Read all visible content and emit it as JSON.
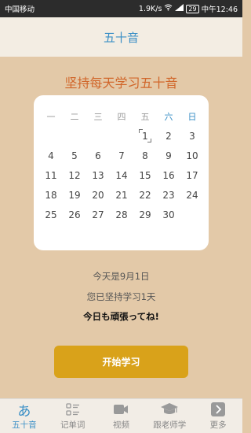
{
  "status": {
    "carrier": "中国移动",
    "speed": "1.9K/s",
    "battery": "29",
    "time": "中午12:46"
  },
  "header": {
    "title": "五十音"
  },
  "main": {
    "heading": "坚持每天学习五十音"
  },
  "calendar": {
    "weekdays": [
      "一",
      "二",
      "三",
      "四",
      "五",
      "六",
      "日"
    ],
    "days": [
      "",
      "",
      "",
      "",
      "1",
      "2",
      "3",
      "4",
      "5",
      "6",
      "7",
      "8",
      "9",
      "10",
      "11",
      "12",
      "13",
      "14",
      "15",
      "16",
      "17",
      "18",
      "19",
      "20",
      "21",
      "22",
      "23",
      "24",
      "25",
      "26",
      "27",
      "28",
      "29",
      "30",
      ""
    ],
    "today": "1"
  },
  "info": {
    "date_text": "今天是9月1日",
    "streak_text": "您已坚持学习1天",
    "motto": "今日も頑張ってね!"
  },
  "start_button": {
    "label": "开始学习"
  },
  "tabs": [
    {
      "label": "五十音",
      "icon": "hiragana-a-icon",
      "active": true
    },
    {
      "label": "记单词",
      "icon": "list-icon",
      "active": false
    },
    {
      "label": "视频",
      "icon": "video-icon",
      "active": false
    },
    {
      "label": "跟老师学",
      "icon": "graduation-cap-icon",
      "active": false
    },
    {
      "label": "更多",
      "icon": "more-arrow-icon",
      "active": false
    }
  ],
  "colors": {
    "accent": "#3a8fc6",
    "heading": "#d1662a",
    "button": "#d9a21a",
    "background": "#e3c9a8"
  }
}
